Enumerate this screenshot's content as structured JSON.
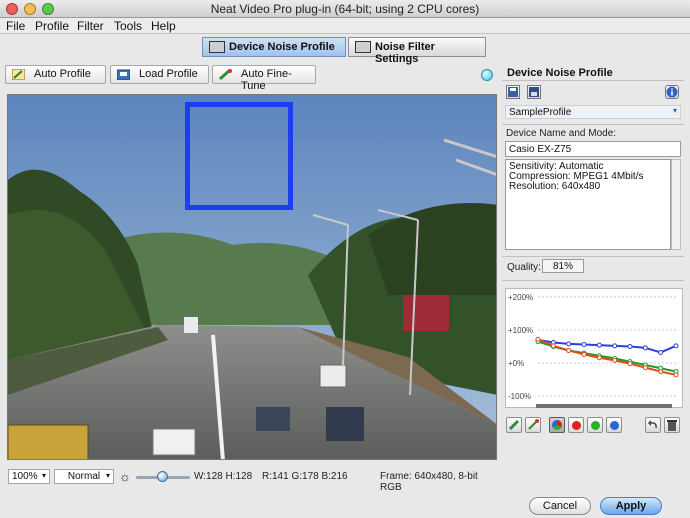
{
  "window": {
    "title": "Neat Video Pro plug-in (64-bit; using 2 CPU cores)"
  },
  "menu": [
    "File",
    "Profile",
    "Filter",
    "Tools",
    "Help"
  ],
  "tabs": [
    {
      "label": "Device Noise Profile",
      "active": true
    },
    {
      "label": "Noise Filter Settings",
      "active": false
    }
  ],
  "toolbar": {
    "auto_profile": "Auto Profile",
    "load_profile": "Load Profile",
    "auto_fine_tune": "Auto Fine-Tune"
  },
  "bottom": {
    "zoom": "100%",
    "mode": "Normal",
    "size_info": "W:128 H:128",
    "rgb_info": "R:141 G:178 B:216",
    "frame_info": "Frame: 640x480, 8-bit RGB"
  },
  "panel": {
    "title": "Device Noise Profile",
    "profile_name": "SampleProfile",
    "device_label": "Device Name and Mode:",
    "device_value": "Casio EX-Z75",
    "details": [
      "Sensitivity: Automatic",
      "Compression: MPEG1 4Mbit/s",
      "Resolution: 640x480"
    ],
    "quality_label": "Quality:",
    "quality_value": "81%",
    "graph": {
      "y_ticks": [
        "+200%",
        "+100%",
        "+0%",
        "-100%"
      ],
      "series": [
        {
          "color": "#2c3fd9",
          "values": [
            70,
            62,
            58,
            56,
            54,
            52,
            50,
            46,
            32,
            52
          ]
        },
        {
          "color": "#1e9e24",
          "values": [
            65,
            50,
            38,
            30,
            22,
            14,
            4,
            -6,
            -16,
            -26
          ]
        },
        {
          "color": "#e34a1e",
          "values": [
            72,
            52,
            38,
            26,
            16,
            8,
            -2,
            -14,
            -26,
            -36
          ]
        }
      ]
    },
    "channel_colors": [
      "#e2201b",
      "#23b323",
      "#2d63d8"
    ]
  },
  "buttons": {
    "cancel": "Cancel",
    "apply": "Apply"
  }
}
